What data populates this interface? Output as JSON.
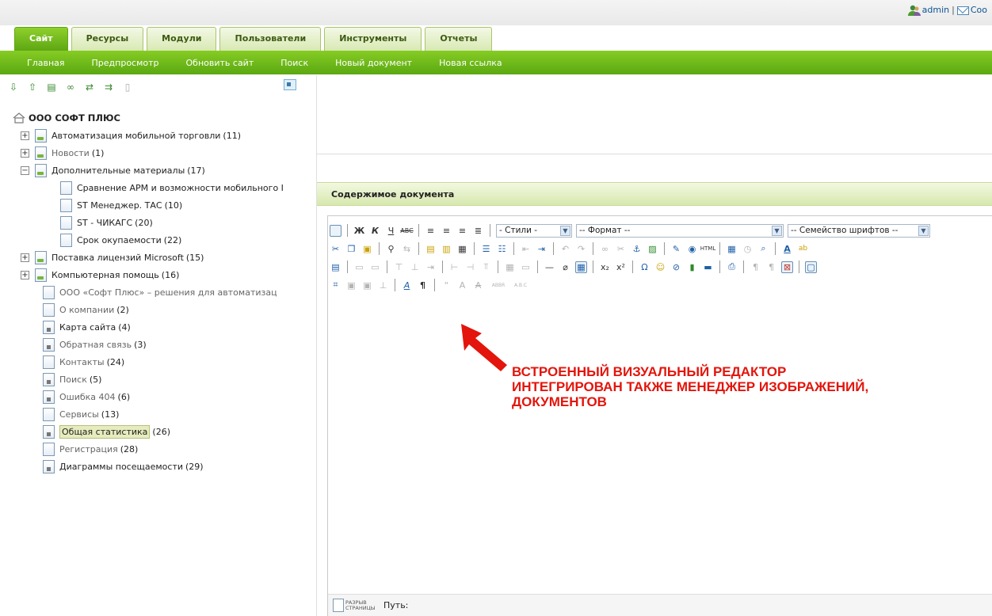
{
  "user": {
    "name": "admin",
    "separator": "|",
    "messages_label": "Coo"
  },
  "tabs": [
    {
      "label": "Сайт"
    },
    {
      "label": "Ресурсы"
    },
    {
      "label": "Модули"
    },
    {
      "label": "Пользователи"
    },
    {
      "label": "Инструменты"
    },
    {
      "label": "Отчеты"
    }
  ],
  "nav": [
    {
      "label": "Главная"
    },
    {
      "label": "Предпросмотр"
    },
    {
      "label": "Обновить сайт"
    },
    {
      "label": "Поиск"
    },
    {
      "label": "Новый документ"
    },
    {
      "label": "Новая ссылка"
    }
  ],
  "tree": {
    "root": "ООО СОФТ ПЛЮС",
    "items": [
      {
        "expander": "+",
        "label": "Автоматизация мобильной торговли",
        "count": "(11)"
      },
      {
        "expander": "+",
        "label": "Новости",
        "count": "(1)"
      },
      {
        "expander": "−",
        "label": "Дополнительные материалы",
        "count": "(17)"
      },
      {
        "label": "Сравнение АРМ и возможности мобильного I",
        "count": ""
      },
      {
        "label": "ST Менеджер. ТАС",
        "count": "(10)"
      },
      {
        "label": "ST - ЧИКАГС",
        "count": "(20)"
      },
      {
        "label": "Срок окупаемости",
        "count": "(22)"
      },
      {
        "expander": "+",
        "label": "Поставка лицензий Microsoft",
        "count": "(15)"
      },
      {
        "expander": "+",
        "label": "Компьютерная помощь",
        "count": "(16)"
      },
      {
        "label": "ООО «Софт Плюс» – решения для автоматизац",
        "count": ""
      },
      {
        "label": "О компании",
        "count": "(2)"
      },
      {
        "label": "Карта сайта",
        "count": "(4)"
      },
      {
        "label": "Обратная связь",
        "count": "(3)"
      },
      {
        "label": "Контакты",
        "count": "(24)"
      },
      {
        "label": "Поиск",
        "count": "(5)"
      },
      {
        "label": "Ошибка 404",
        "count": "(6)"
      },
      {
        "label": "Сервисы",
        "count": "(13)"
      },
      {
        "label": "Общая статистика",
        "count": "(26)"
      },
      {
        "label": "Регистрация",
        "count": "(28)"
      },
      {
        "label": "Диаграммы посещаемости",
        "count": "(29)"
      }
    ]
  },
  "content_header": "Содержимое документа",
  "editor": {
    "styles_select": "- Стили -",
    "format_select": "-- Формат --",
    "font_select": "-- Семейство шрифтов --",
    "path_label": "Путь:",
    "pagebreak_label_1": "РАЗРЫВ",
    "pagebreak_label_2": "СТРАНИЦЫ"
  },
  "annotation": {
    "line1": "ВСТРОЕННЫЙ ВИЗУАЛЬНЫЙ РЕДАКТОР",
    "line2": "ИНТЕГРИРОВАН ТАКЖЕ МЕНЕДЖЕР ИЗОБРАЖЕНИЙ,",
    "line3": "ДОКУМЕНТОВ"
  }
}
